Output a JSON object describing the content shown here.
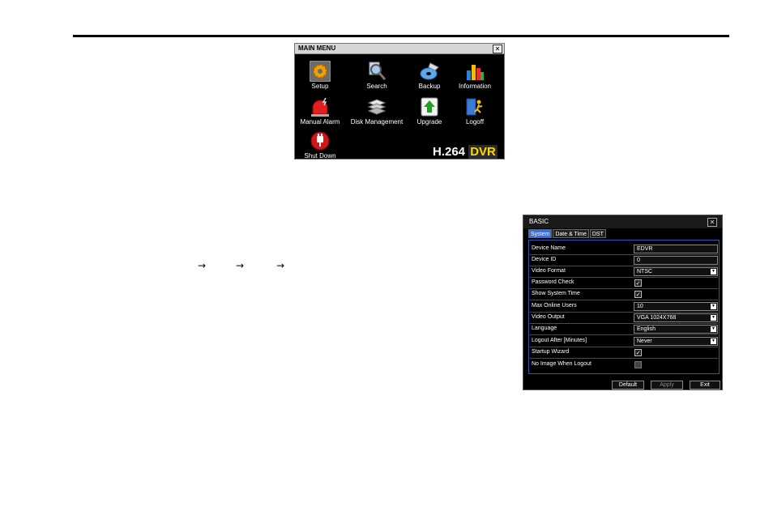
{
  "arrows": [
    "→",
    "→",
    "→"
  ],
  "main_menu": {
    "title": "MAIN MENU",
    "close": "✕",
    "items": [
      {
        "label": "Setup",
        "icon": "gear-icon"
      },
      {
        "label": "Search",
        "icon": "magnifier-icon"
      },
      {
        "label": "Backup",
        "icon": "disc-backup-icon"
      },
      {
        "label": "Information",
        "icon": "bar-chart-icon"
      },
      {
        "label": "Manual Alarm",
        "icon": "alarm-siren-icon"
      },
      {
        "label": "Disk Management",
        "icon": "disk-stack-icon"
      },
      {
        "label": "Upgrade",
        "icon": "upgrade-arrow-icon"
      },
      {
        "label": "Logoff",
        "icon": "logoff-person-icon"
      },
      {
        "label": "Shut Down",
        "icon": "power-plug-icon"
      }
    ],
    "brand_main": "H.264",
    "brand_dvr": "DVR"
  },
  "basic": {
    "title": "BASIC",
    "close": "✕",
    "tabs": [
      "System",
      "Date & Time",
      "DST"
    ],
    "rows": [
      {
        "label": "Device Name",
        "type": "text",
        "value": "EDVR"
      },
      {
        "label": "Device ID",
        "type": "text",
        "value": "0"
      },
      {
        "label": "Video Format",
        "type": "select",
        "value": "NTSC"
      },
      {
        "label": "Password Check",
        "type": "check",
        "checked": true
      },
      {
        "label": "Show System Time",
        "type": "check",
        "checked": true
      },
      {
        "label": "Max Online Users",
        "type": "select",
        "value": "10"
      },
      {
        "label": "Video Output",
        "type": "select",
        "value": "VGA 1024X768"
      },
      {
        "label": "Language",
        "type": "select",
        "value": "English"
      },
      {
        "label": "Logout After [Minutes]",
        "type": "select",
        "value": "Never"
      },
      {
        "label": "Startup Wizard",
        "type": "check",
        "checked": true
      },
      {
        "label": "No Image When Logout",
        "type": "check",
        "checked": false
      }
    ],
    "buttons": {
      "default": "Default",
      "apply": "Apply",
      "exit": "Exit"
    }
  }
}
